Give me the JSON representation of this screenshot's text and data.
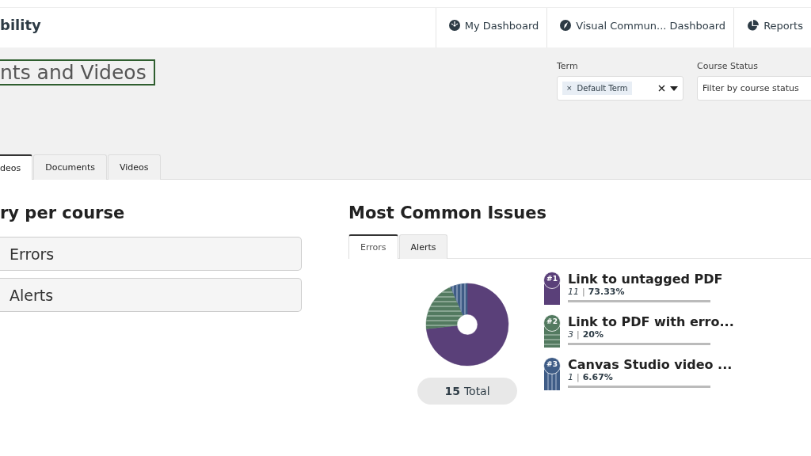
{
  "header": {
    "brand": "bility",
    "nav": [
      {
        "label": "My Dashboard"
      },
      {
        "label": "Visual Commun... Dashboard"
      },
      {
        "label": "Reports"
      }
    ]
  },
  "page_title": "nts and Videos",
  "filters": [
    {
      "kind": "tags",
      "label": "Term",
      "tags": [
        {
          "remove": "×",
          "label": "Default Term"
        }
      ]
    },
    {
      "kind": "select",
      "label": "Course Status",
      "placeholder": "Filter by course status"
    }
  ],
  "tabs": [
    {
      "label": "deos",
      "selected": true
    },
    {
      "label": "Documents",
      "selected": false
    },
    {
      "label": "Videos",
      "selected": false
    }
  ],
  "summary": {
    "heading": "ry per course",
    "cards": [
      {
        "label": "Errors"
      },
      {
        "label": "Alerts"
      }
    ]
  },
  "issues": {
    "heading": "Most Common Issues",
    "tabs": [
      {
        "label": "Errors",
        "selected": true
      },
      {
        "label": "Alerts",
        "selected": false
      }
    ],
    "chart_data": {
      "type": "donut",
      "values": [
        73.33,
        20,
        6.67
      ]
    },
    "total_number": "15",
    "total_label": "Total",
    "items": [
      {
        "rank": "#1",
        "title": "Link to untagged PDF",
        "count": "11",
        "separator": "|",
        "percent": "73.33%",
        "color": "#5a4079",
        "kind": "solid"
      },
      {
        "rank": "#2",
        "title": "Link to PDF with erro...",
        "count": "3",
        "separator": "|",
        "percent": "20%",
        "color": "#537a60",
        "kind": "striped"
      },
      {
        "rank": "#3",
        "title": "Canvas Studio video ...",
        "count": "1",
        "separator": "|",
        "percent": "6.67%",
        "color": "#3f5c86",
        "kind": "ribbed"
      }
    ]
  }
}
